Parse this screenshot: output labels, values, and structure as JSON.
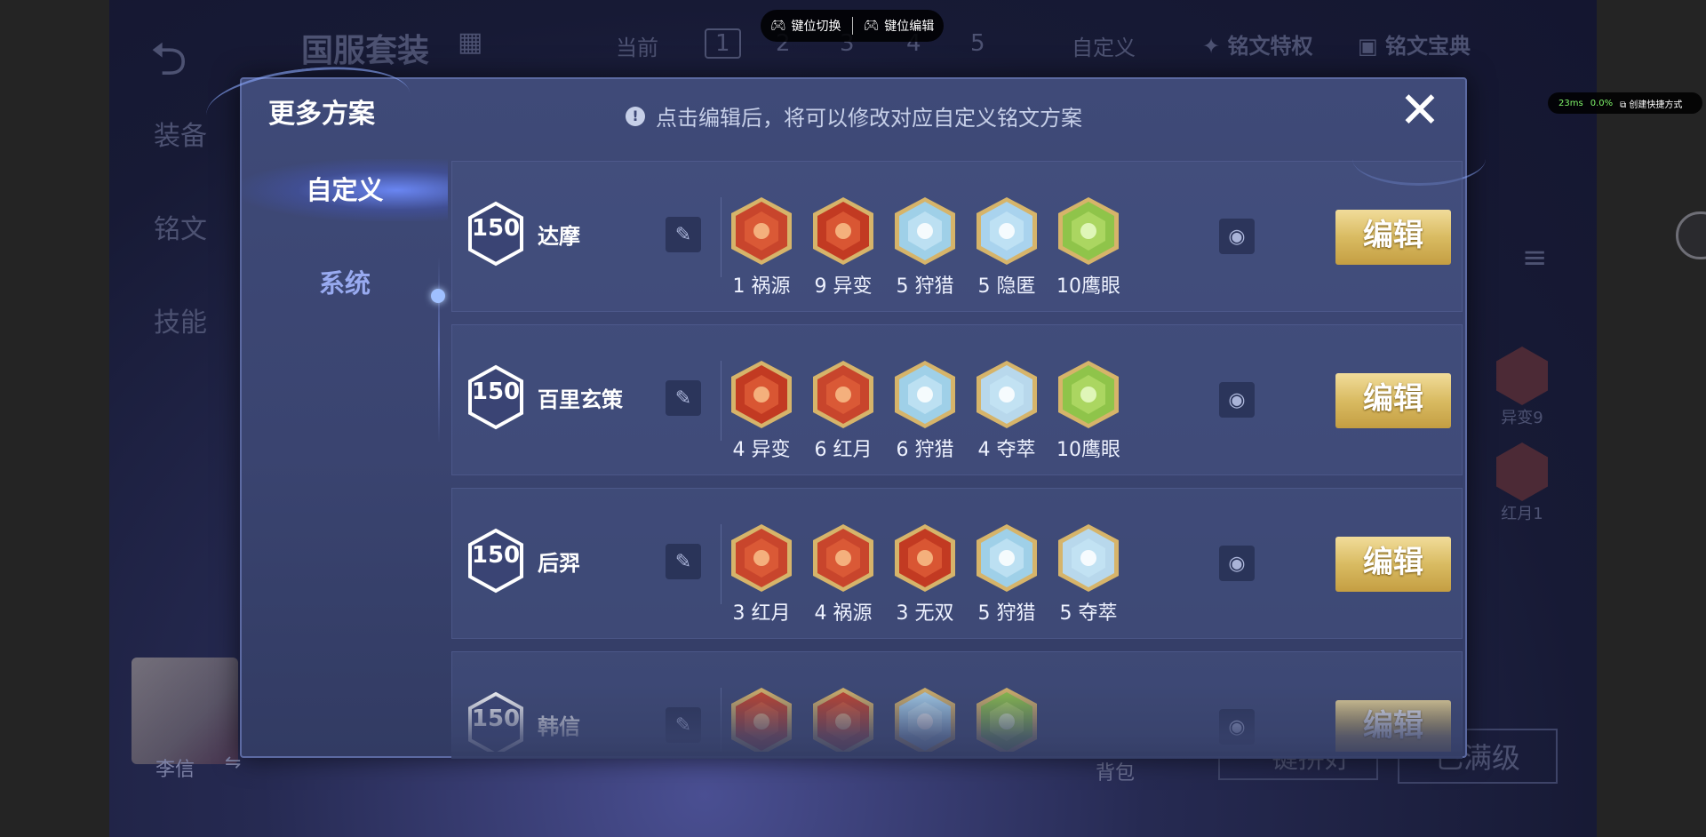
{
  "background": {
    "left_menu": [
      "装备",
      "铭文",
      "技能"
    ],
    "header_title": "国服套装",
    "current_label": "当前",
    "slots": [
      "1",
      "2",
      "3",
      "4",
      "5"
    ],
    "custom_label": "自定义",
    "privilege_label": "铭文特权",
    "codex_label": "铭文宝典",
    "side_runes": [
      {
        "label": "异变9"
      },
      {
        "label": "红月1"
      }
    ],
    "hero_name": "李信",
    "backpack_label": "背包",
    "recommend_label": "一键拼好",
    "maxed_label": "已满级"
  },
  "overlay": {
    "key_switch": "键位切换",
    "key_edit": "键位编辑",
    "ping": "23ms",
    "loss": "0.0%",
    "shortcut": "创建快捷方式"
  },
  "modal": {
    "title": "更多方案",
    "tip": "点击编辑后，将可以修改对应自定义铭文方案",
    "close_label": "✕",
    "tabs": [
      {
        "label": "自定义"
      },
      {
        "label": "系统"
      }
    ],
    "edit_label": "编辑",
    "plans": [
      {
        "level": "150",
        "hero": "达摩",
        "runes": [
          {
            "label": "1 祸源",
            "color": "#c8452c",
            "kind": "red"
          },
          {
            "label": "9 异变",
            "color": "#c23a22",
            "kind": "red"
          },
          {
            "label": "5 狩猎",
            "color": "#9fd0e8",
            "kind": "blue"
          },
          {
            "label": "5 隐匿",
            "color": "#a9d3ee",
            "kind": "blue"
          },
          {
            "label": "10鹰眼",
            "color": "#8fc44a",
            "kind": "green"
          }
        ]
      },
      {
        "level": "150",
        "hero": "百里玄策",
        "runes": [
          {
            "label": "4 异变",
            "color": "#c23a22",
            "kind": "red"
          },
          {
            "label": "6 红月",
            "color": "#c8452c",
            "kind": "red"
          },
          {
            "label": "6 狩猎",
            "color": "#9fd0e8",
            "kind": "blue"
          },
          {
            "label": "4 夺萃",
            "color": "#b8d8ec",
            "kind": "blue"
          },
          {
            "label": "10鹰眼",
            "color": "#8fc44a",
            "kind": "green"
          }
        ]
      },
      {
        "level": "150",
        "hero": "后羿",
        "runes": [
          {
            "label": "3 红月",
            "color": "#c8452c",
            "kind": "red"
          },
          {
            "label": "4 祸源",
            "color": "#c8452c",
            "kind": "red"
          },
          {
            "label": "3 无双",
            "color": "#c23a22",
            "kind": "red"
          },
          {
            "label": "5 狩猎",
            "color": "#9fd0e8",
            "kind": "blue"
          },
          {
            "label": "5 夺萃",
            "color": "#b8d8ec",
            "kind": "blue"
          }
        ]
      },
      {
        "level": "150",
        "hero": "韩信",
        "runes": [
          {
            "label": "",
            "color": "#c8452c",
            "kind": "red"
          },
          {
            "label": "",
            "color": "#c8452c",
            "kind": "red"
          },
          {
            "label": "",
            "color": "#a9d3ee",
            "kind": "blue"
          },
          {
            "label": "",
            "color": "#8fc44a",
            "kind": "green"
          }
        ]
      }
    ]
  }
}
